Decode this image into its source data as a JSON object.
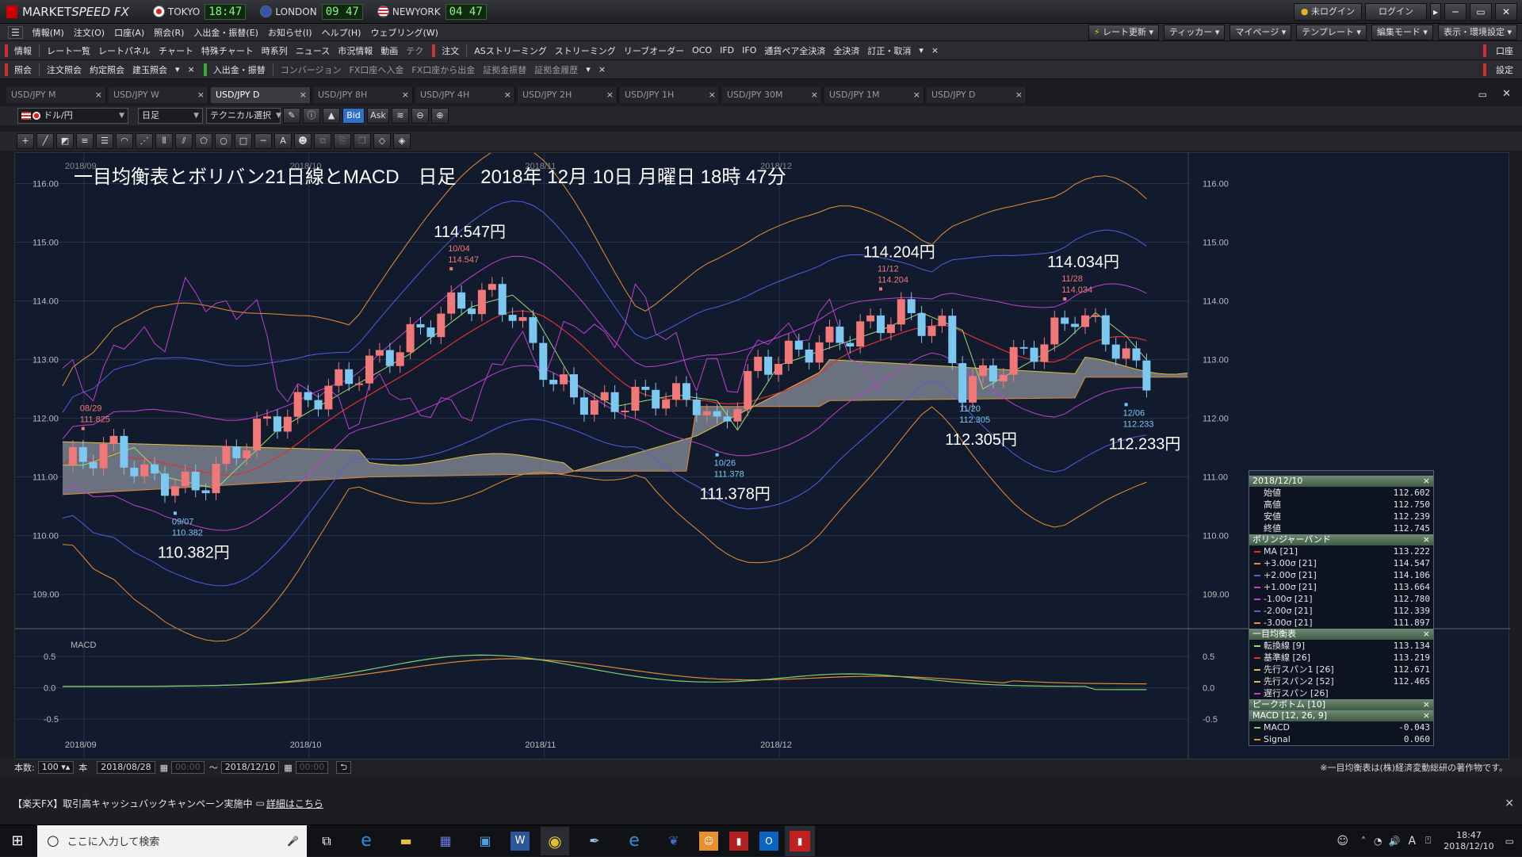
{
  "app": {
    "logo_a": "MARKET",
    "logo_b": "SPEED FX"
  },
  "clocks": [
    {
      "city": "TOKYO",
      "time": "18:47",
      "flag": "#d22"
    },
    {
      "city": "LONDON",
      "time": "09 47",
      "flag": "#3355aa"
    },
    {
      "city": "NEWYORK",
      "time": "04 47",
      "flag": "#3355aa"
    }
  ],
  "title_buttons": {
    "not_logged": "未ログイン",
    "login": "ログイン",
    "login_arrow": "▸"
  },
  "window_controls": {
    "min": "─",
    "max": "▭",
    "close": "✕"
  },
  "menu": [
    "情報(M)",
    "注文(O)",
    "口座(A)",
    "照会(R)",
    "入出金・振替(E)",
    "お知らせ(I)",
    "ヘルプ(H)",
    "ウェブリング(W)"
  ],
  "menu_right": [
    "レート更新",
    "ティッカー",
    "マイページ",
    "テンプレート",
    "編集モード",
    "表示・環境設定"
  ],
  "toolbar1": {
    "info_label": "情報",
    "items": [
      "レート一覧",
      "レートパネル",
      "チャート",
      "特殊チャート",
      "時系列",
      "ニュース",
      "市況情報",
      "動画",
      "テク"
    ],
    "order_label": "注文",
    "order_items": [
      "ASストリーミング",
      "ストリーミング",
      "リーブオーダー",
      "OCO",
      "IFD",
      "IFO",
      "通貨ペア全決済",
      "全決済",
      "訂正・取消"
    ],
    "more": "▾",
    "close": "×",
    "right": "口座"
  },
  "toolbar2": {
    "inquiry_label": "照会",
    "items": [
      "注文照会",
      "約定照会",
      "建玉照会"
    ],
    "deposit_label": "入出金・振替",
    "deposit_items": [
      "コンバージョン",
      "FX口座へ入金",
      "FX口座から出金",
      "証拠金振替",
      "証拠金履歴"
    ],
    "more": "▾",
    "close": "×",
    "right": "設定"
  },
  "chart_tabs": [
    "USD/JPY M",
    "USD/JPY W",
    "USD/JPY D",
    "USD/JPY 8H",
    "USD/JPY 4H",
    "USD/JPY 2H",
    "USD/JPY 1H",
    "USD/JPY 30M",
    "USD/JPY 1M",
    "USD/JPY D"
  ],
  "chart_tab_close": "×",
  "chart_controls": {
    "pair": "ドル/円",
    "timeframe": "日足",
    "technical": "テクニカル選択",
    "bid": "Bid",
    "ask": "Ask"
  },
  "chart_data": {
    "type": "candlestick",
    "title": "一目均衡表とボリバン21日線とMACD　日足　 2018年 12月 10日 月曜日 18時 47分",
    "y_ticks": [
      "116.00",
      "115.00",
      "114.00",
      "113.00",
      "112.00",
      "111.00",
      "110.00",
      "109.00"
    ],
    "macd_ticks": [
      "0.5",
      "0.0",
      "-0.5"
    ],
    "macd_label": "MACD",
    "x_labels": [
      "2018/09",
      "2018/10",
      "2018/11",
      "2018/12"
    ],
    "annotations": [
      {
        "date": "08/29",
        "price": "111.825"
      },
      {
        "date": "09/07",
        "price": "110.382",
        "big": "110.382円"
      },
      {
        "date": "10/04",
        "price": "114.547",
        "big": "114.547円"
      },
      {
        "date": "10/26",
        "price": "111.378",
        "big": "111.378円"
      },
      {
        "date": "11/12",
        "price": "114.204",
        "big": "114.204円"
      },
      {
        "date": "11/20",
        "price": "112.305",
        "big": "112.305円"
      },
      {
        "date": "11/28",
        "price": "114.034",
        "big": "114.034円"
      },
      {
        "date": "12/06",
        "price": "112.233",
        "big": "112.233円"
      }
    ]
  },
  "info_panel": {
    "date": "2018/12/10",
    "ohlc": [
      {
        "label": "始値",
        "value": "112.602"
      },
      {
        "label": "高値",
        "value": "112.750"
      },
      {
        "label": "安値",
        "value": "112.239"
      },
      {
        "label": "終値",
        "value": "112.745"
      }
    ],
    "bb_title": "ボリンジャーバンド",
    "bb": [
      {
        "label": "MA [21]",
        "value": "113.222",
        "color": "#e03030"
      },
      {
        "label": "+3.00σ [21]",
        "value": "114.547",
        "color": "#e89030"
      },
      {
        "label": "+2.00σ [21]",
        "value": "114.106",
        "color": "#5060e0"
      },
      {
        "label": "+1.00σ [21]",
        "value": "113.664",
        "color": "#c040d0"
      },
      {
        "label": "-1.00σ [21]",
        "value": "112.780",
        "color": "#c040d0"
      },
      {
        "label": "-2.00σ [21]",
        "value": "112.339",
        "color": "#5060e0"
      },
      {
        "label": "-3.00σ [21]",
        "value": "111.897",
        "color": "#e89030"
      }
    ],
    "ichi_title": "一目均衡表",
    "ichi": [
      {
        "label": "転換線 [9]",
        "value": "113.134",
        "color": "#90e070"
      },
      {
        "label": "基準線 [26]",
        "value": "113.219",
        "color": "#e03030"
      },
      {
        "label": "先行スパン1 [26]",
        "value": "112.671",
        "color": "#e0c040"
      },
      {
        "label": "先行スパン2 [52]",
        "value": "112.465",
        "color": "#e0c040"
      },
      {
        "label": "遅行スパン [26]",
        "value": "",
        "color": "#c040d0"
      }
    ],
    "peak_title": "ピークボトム [10]",
    "macd_title": "MACD [12, 26, 9]",
    "macd": [
      {
        "label": "MACD",
        "value": "-0.043",
        "color": "#7ad070"
      },
      {
        "label": "Signal",
        "value": "0.060",
        "color": "#e89030"
      }
    ]
  },
  "bottom": {
    "count_label": "本数:",
    "count": "100",
    "count_unit": "本",
    "from_date": "2018/08/28",
    "from_time": "00:00",
    "tilde": "～",
    "to_date": "2018/12/10",
    "to_time": "00:00",
    "copyright": "※一目均衡表は(株)経済変動総研の著作物です。"
  },
  "banner": {
    "text": "【楽天FX】取引高キャッシュバックキャンペーン実施中",
    "link": "詳細はこちら",
    "close": "×"
  },
  "taskbar": {
    "search": "ここに入力して検索",
    "time": "18:47",
    "date": "2018/12/10",
    "ime": "A"
  }
}
